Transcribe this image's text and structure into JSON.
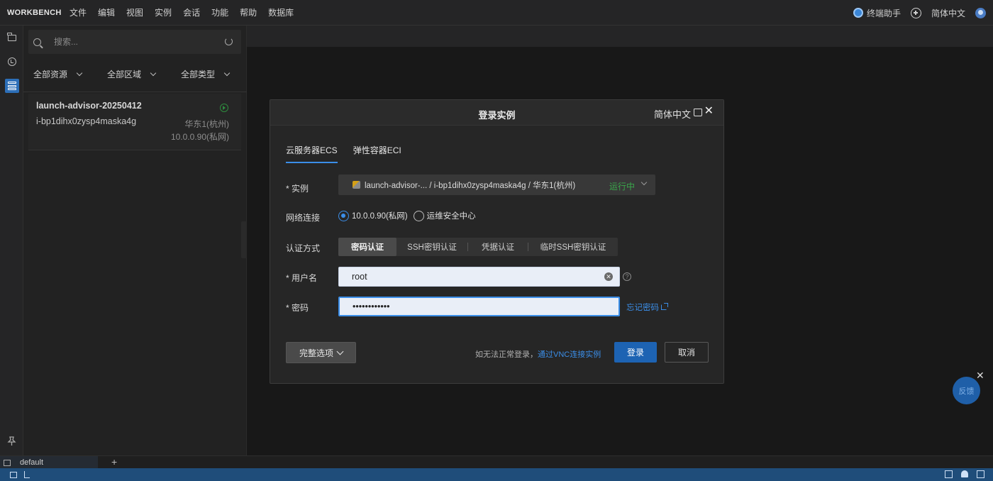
{
  "topbar": {
    "brand": "WORKBENCH",
    "menu": [
      "文件",
      "编辑",
      "视图",
      "实例",
      "会话",
      "功能",
      "帮助",
      "数据库"
    ],
    "assistant": "终端助手",
    "language": "简体中文"
  },
  "sidebar": {
    "search_placeholder": "搜索...",
    "filters": [
      "全部资源",
      "全部区域",
      "全部类型"
    ],
    "instance": {
      "name": "launch-advisor-20250412",
      "id": "i-bp1dihx0zysp4maska4g",
      "region": "华东1(杭州)",
      "ip": "10.0.0.90(私网)"
    }
  },
  "modal": {
    "title": "登录实例",
    "language": "简体中文",
    "close": "✕",
    "tabs": [
      "云服务器ECS",
      "弹性容器ECI"
    ],
    "instance_label": "* 实例",
    "instance_value": "launch-advisor-...  / i-bp1dihx0zysp4maska4g  / 华东1(杭州)",
    "instance_status": "运行中",
    "network_label": "网络连接",
    "network_options": [
      "10.0.0.90(私网)",
      "运维安全中心"
    ],
    "auth_label": "认证方式",
    "auth_options": [
      "密码认证",
      "SSH密钥认证",
      "凭据认证",
      "临时SSH密钥认证"
    ],
    "username_label": "* 用户名",
    "username_value": "root",
    "password_label": "* 密码",
    "password_value": "••••••••••••",
    "forgot_password": "忘记密码",
    "full_options": "完整选项",
    "vnc_prefix": "如无法正常登录，",
    "vnc_link": "通过VNC连接实例",
    "login": "登录",
    "cancel": "取消"
  },
  "panel": {
    "terminal_tab": "default",
    "add": "+"
  },
  "feedback": {
    "label": "反馈",
    "close": "✕"
  },
  "colors": {
    "accent": "#3b8ee8",
    "primary_button": "#1d63b3",
    "running_status": "#3aa84b",
    "statusbar": "#1f4d7a"
  },
  "icons": [
    "folder-icon",
    "history-icon",
    "instances-icon",
    "pin-icon",
    "search-icon",
    "refresh-icon",
    "run-icon",
    "terminal-icon",
    "shirt-icon",
    "help-icon",
    "external-link-icon"
  ]
}
